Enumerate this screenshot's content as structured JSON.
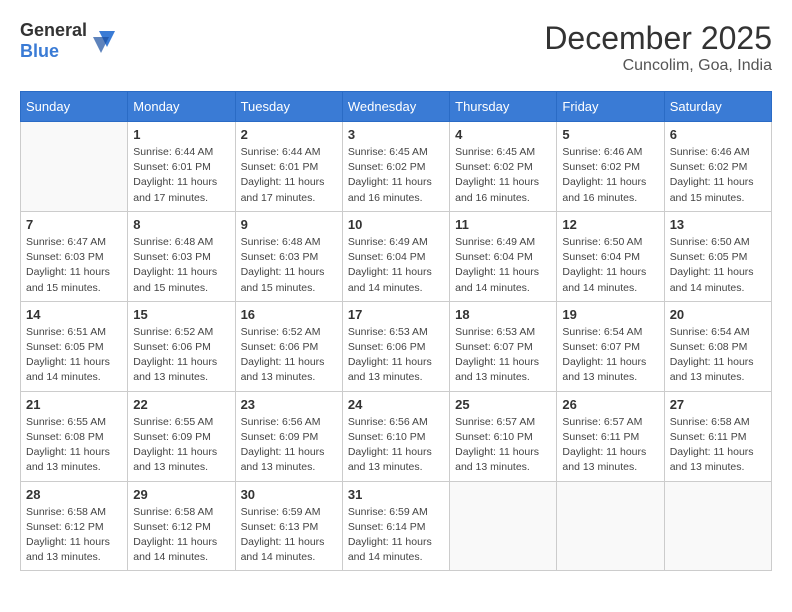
{
  "header": {
    "logo_general": "General",
    "logo_blue": "Blue",
    "month": "December 2025",
    "location": "Cuncolim, Goa, India"
  },
  "weekdays": [
    "Sunday",
    "Monday",
    "Tuesday",
    "Wednesday",
    "Thursday",
    "Friday",
    "Saturday"
  ],
  "weeks": [
    [
      {
        "day": "",
        "info": ""
      },
      {
        "day": "1",
        "info": "Sunrise: 6:44 AM\nSunset: 6:01 PM\nDaylight: 11 hours\nand 17 minutes."
      },
      {
        "day": "2",
        "info": "Sunrise: 6:44 AM\nSunset: 6:01 PM\nDaylight: 11 hours\nand 17 minutes."
      },
      {
        "day": "3",
        "info": "Sunrise: 6:45 AM\nSunset: 6:02 PM\nDaylight: 11 hours\nand 16 minutes."
      },
      {
        "day": "4",
        "info": "Sunrise: 6:45 AM\nSunset: 6:02 PM\nDaylight: 11 hours\nand 16 minutes."
      },
      {
        "day": "5",
        "info": "Sunrise: 6:46 AM\nSunset: 6:02 PM\nDaylight: 11 hours\nand 16 minutes."
      },
      {
        "day": "6",
        "info": "Sunrise: 6:46 AM\nSunset: 6:02 PM\nDaylight: 11 hours\nand 15 minutes."
      }
    ],
    [
      {
        "day": "7",
        "info": "Sunrise: 6:47 AM\nSunset: 6:03 PM\nDaylight: 11 hours\nand 15 minutes."
      },
      {
        "day": "8",
        "info": "Sunrise: 6:48 AM\nSunset: 6:03 PM\nDaylight: 11 hours\nand 15 minutes."
      },
      {
        "day": "9",
        "info": "Sunrise: 6:48 AM\nSunset: 6:03 PM\nDaylight: 11 hours\nand 15 minutes."
      },
      {
        "day": "10",
        "info": "Sunrise: 6:49 AM\nSunset: 6:04 PM\nDaylight: 11 hours\nand 14 minutes."
      },
      {
        "day": "11",
        "info": "Sunrise: 6:49 AM\nSunset: 6:04 PM\nDaylight: 11 hours\nand 14 minutes."
      },
      {
        "day": "12",
        "info": "Sunrise: 6:50 AM\nSunset: 6:04 PM\nDaylight: 11 hours\nand 14 minutes."
      },
      {
        "day": "13",
        "info": "Sunrise: 6:50 AM\nSunset: 6:05 PM\nDaylight: 11 hours\nand 14 minutes."
      }
    ],
    [
      {
        "day": "14",
        "info": "Sunrise: 6:51 AM\nSunset: 6:05 PM\nDaylight: 11 hours\nand 14 minutes."
      },
      {
        "day": "15",
        "info": "Sunrise: 6:52 AM\nSunset: 6:06 PM\nDaylight: 11 hours\nand 13 minutes."
      },
      {
        "day": "16",
        "info": "Sunrise: 6:52 AM\nSunset: 6:06 PM\nDaylight: 11 hours\nand 13 minutes."
      },
      {
        "day": "17",
        "info": "Sunrise: 6:53 AM\nSunset: 6:06 PM\nDaylight: 11 hours\nand 13 minutes."
      },
      {
        "day": "18",
        "info": "Sunrise: 6:53 AM\nSunset: 6:07 PM\nDaylight: 11 hours\nand 13 minutes."
      },
      {
        "day": "19",
        "info": "Sunrise: 6:54 AM\nSunset: 6:07 PM\nDaylight: 11 hours\nand 13 minutes."
      },
      {
        "day": "20",
        "info": "Sunrise: 6:54 AM\nSunset: 6:08 PM\nDaylight: 11 hours\nand 13 minutes."
      }
    ],
    [
      {
        "day": "21",
        "info": "Sunrise: 6:55 AM\nSunset: 6:08 PM\nDaylight: 11 hours\nand 13 minutes."
      },
      {
        "day": "22",
        "info": "Sunrise: 6:55 AM\nSunset: 6:09 PM\nDaylight: 11 hours\nand 13 minutes."
      },
      {
        "day": "23",
        "info": "Sunrise: 6:56 AM\nSunset: 6:09 PM\nDaylight: 11 hours\nand 13 minutes."
      },
      {
        "day": "24",
        "info": "Sunrise: 6:56 AM\nSunset: 6:10 PM\nDaylight: 11 hours\nand 13 minutes."
      },
      {
        "day": "25",
        "info": "Sunrise: 6:57 AM\nSunset: 6:10 PM\nDaylight: 11 hours\nand 13 minutes."
      },
      {
        "day": "26",
        "info": "Sunrise: 6:57 AM\nSunset: 6:11 PM\nDaylight: 11 hours\nand 13 minutes."
      },
      {
        "day": "27",
        "info": "Sunrise: 6:58 AM\nSunset: 6:11 PM\nDaylight: 11 hours\nand 13 minutes."
      }
    ],
    [
      {
        "day": "28",
        "info": "Sunrise: 6:58 AM\nSunset: 6:12 PM\nDaylight: 11 hours\nand 13 minutes."
      },
      {
        "day": "29",
        "info": "Sunrise: 6:58 AM\nSunset: 6:12 PM\nDaylight: 11 hours\nand 14 minutes."
      },
      {
        "day": "30",
        "info": "Sunrise: 6:59 AM\nSunset: 6:13 PM\nDaylight: 11 hours\nand 14 minutes."
      },
      {
        "day": "31",
        "info": "Sunrise: 6:59 AM\nSunset: 6:14 PM\nDaylight: 11 hours\nand 14 minutes."
      },
      {
        "day": "",
        "info": ""
      },
      {
        "day": "",
        "info": ""
      },
      {
        "day": "",
        "info": ""
      }
    ]
  ]
}
